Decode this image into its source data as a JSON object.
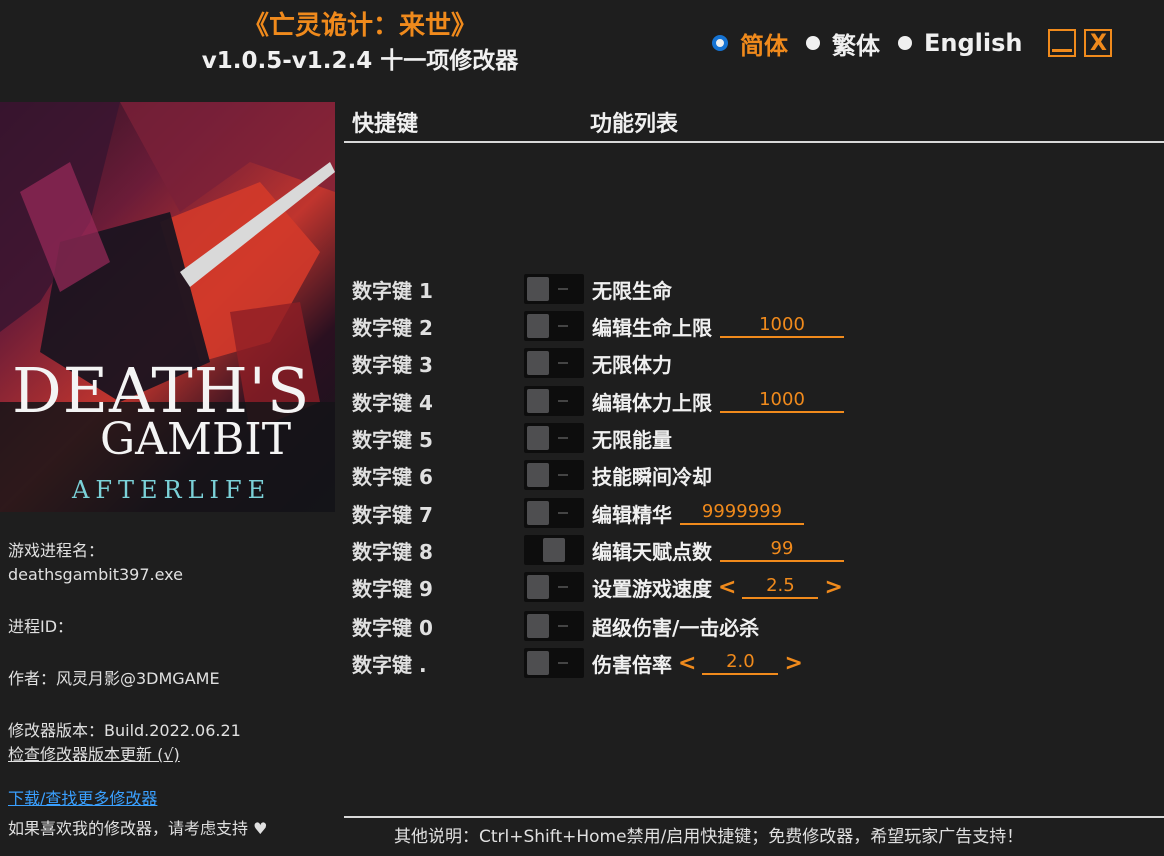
{
  "header": {
    "title": "《亡灵诡计：来世》",
    "subtitle": "v1.0.5-v1.2.4 十一项修改器"
  },
  "languages": [
    {
      "label": "简体",
      "selected": true
    },
    {
      "label": "繁体",
      "selected": false
    },
    {
      "label": "English",
      "selected": false
    }
  ],
  "window_controls": {
    "close_label": "X"
  },
  "cover": {
    "logo_line1": "DEATH'S",
    "logo_line2": "GAMBIT",
    "logo_line3": "AFTERLIFE"
  },
  "info": {
    "process_label": "游戏进程名：",
    "process_value": "deathsgambit397.exe",
    "pid_label": "进程ID：",
    "author": "作者：风灵月影@3DMGAME",
    "version": "修改器版本：Build.2022.06.21",
    "check_update": "检查修改器版本更新 (√)",
    "download": "下载/查找更多修改器",
    "support": "如果喜欢我的修改器，请考虑支持 ♥"
  },
  "columns": {
    "hotkey": "快捷键",
    "features": "功能列表"
  },
  "cheats": [
    {
      "hotkey": "数字键 1",
      "label": "无限生命",
      "value": "",
      "arrows": false
    },
    {
      "hotkey": "数字键 2",
      "label": "编辑生命上限",
      "value": "1000",
      "arrows": false
    },
    {
      "hotkey": "数字键 3",
      "label": "无限体力",
      "value": "",
      "arrows": false
    },
    {
      "hotkey": "数字键 4",
      "label": "编辑体力上限",
      "value": "1000",
      "arrows": false
    },
    {
      "hotkey": "数字键 5",
      "label": "无限能量",
      "value": "",
      "arrows": false
    },
    {
      "hotkey": "数字键 6",
      "label": "技能瞬间冷却",
      "value": "",
      "arrows": false
    },
    {
      "hotkey": "数字键 7",
      "label": "编辑精华",
      "value": "9999999",
      "arrows": false
    },
    {
      "hotkey": "数字键 8",
      "label": "编辑天赋点数",
      "value": "99",
      "arrows": false
    },
    {
      "hotkey": "数字键 9",
      "label": "设置游戏速度",
      "value": "2.5",
      "arrows": true
    },
    {
      "hotkey": "数字键 0",
      "label": "超级伤害/一击必杀",
      "value": "",
      "arrows": false
    },
    {
      "hotkey": "数字键 .",
      "label": "伤害倍率",
      "value": "2.0",
      "arrows": true
    }
  ],
  "arrows": {
    "left": "<",
    "right": ">"
  },
  "footer": "其他说明：Ctrl+Shift+Home禁用/启用快捷键；免费修改器，希望玩家广告支持！",
  "colors": {
    "accent": "#f08a1c",
    "radio_selected": "#1673d2",
    "link": "#3aa0ff",
    "background": "#1e1e1e"
  }
}
